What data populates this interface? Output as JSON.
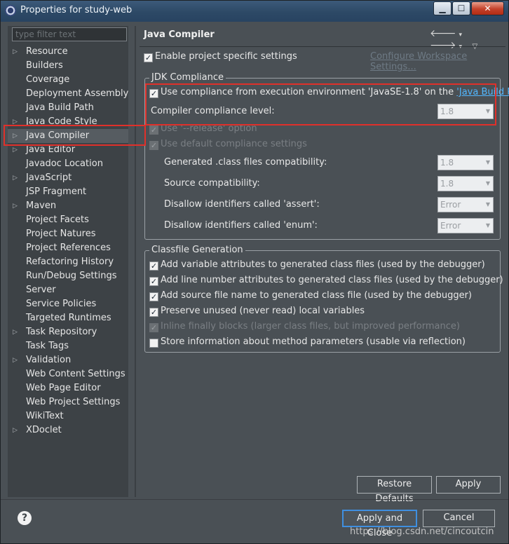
{
  "window": {
    "title": "Properties for study-web"
  },
  "filter": {
    "placeholder": "type filter text"
  },
  "tree": [
    {
      "label": "Resource",
      "expandable": true
    },
    {
      "label": "Builders",
      "expandable": false
    },
    {
      "label": "Coverage",
      "expandable": false
    },
    {
      "label": "Deployment Assembly",
      "expandable": false
    },
    {
      "label": "Java Build Path",
      "expandable": false
    },
    {
      "label": "Java Code Style",
      "expandable": true
    },
    {
      "label": "Java Compiler",
      "expandable": true,
      "selected": true
    },
    {
      "label": "Java Editor",
      "expandable": true
    },
    {
      "label": "Javadoc Location",
      "expandable": false
    },
    {
      "label": "JavaScript",
      "expandable": true
    },
    {
      "label": "JSP Fragment",
      "expandable": false
    },
    {
      "label": "Maven",
      "expandable": true
    },
    {
      "label": "Project Facets",
      "expandable": false
    },
    {
      "label": "Project Natures",
      "expandable": false
    },
    {
      "label": "Project References",
      "expandable": false
    },
    {
      "label": "Refactoring History",
      "expandable": false
    },
    {
      "label": "Run/Debug Settings",
      "expandable": false
    },
    {
      "label": "Server",
      "expandable": false
    },
    {
      "label": "Service Policies",
      "expandable": false
    },
    {
      "label": "Targeted Runtimes",
      "expandable": false
    },
    {
      "label": "Task Repository",
      "expandable": true
    },
    {
      "label": "Task Tags",
      "expandable": false
    },
    {
      "label": "Validation",
      "expandable": true
    },
    {
      "label": "Web Content Settings",
      "expandable": false
    },
    {
      "label": "Web Page Editor",
      "expandable": false
    },
    {
      "label": "Web Project Settings",
      "expandable": false
    },
    {
      "label": "WikiText",
      "expandable": false
    },
    {
      "label": "XDoclet",
      "expandable": true
    }
  ],
  "page": {
    "title": "Java Compiler",
    "enable_specific": "Enable project specific settings",
    "configure_workspace": "Configure Workspace Settings..."
  },
  "jdk": {
    "legend": "JDK Compliance",
    "use_compliance_prefix": "Use compliance from execution environment 'JavaSE-1.8' on the ",
    "java_build_path_link": "'Java Build Path'",
    "compliance_level_label": "Compiler compliance level:",
    "compliance_level_value": "1.8",
    "use_release": "Use '--release' option",
    "use_default": "Use default compliance settings",
    "generated_label": "Generated .class files compatibility:",
    "generated_value": "1.8",
    "source_label": "Source compatibility:",
    "source_value": "1.8",
    "assert_label": "Disallow identifiers called 'assert':",
    "assert_value": "Error",
    "enum_label": "Disallow identifiers called 'enum':",
    "enum_value": "Error"
  },
  "classfile": {
    "legend": "Classfile Generation",
    "items": [
      {
        "label": "Add variable attributes to generated class files (used by the debugger)",
        "checked": true,
        "disabled": false
      },
      {
        "label": "Add line number attributes to generated class files (used by the debugger)",
        "checked": true,
        "disabled": false
      },
      {
        "label": "Add source file name to generated class file (used by the debugger)",
        "checked": true,
        "disabled": false
      },
      {
        "label": "Preserve unused (never read) local variables",
        "checked": true,
        "disabled": false
      },
      {
        "label": "Inline finally blocks (larger class files, but improved performance)",
        "checked": true,
        "disabled": true
      },
      {
        "label": "Store information about method parameters (usable via reflection)",
        "checked": false,
        "disabled": false
      }
    ]
  },
  "buttons": {
    "restore_defaults": "Restore Defaults",
    "apply": "Apply",
    "apply_and_close": "Apply and Close",
    "cancel": "Cancel"
  },
  "watermark": "https://blog.csdn.net/cincoutcin",
  "colors": {
    "highlight_box": "#e0302a",
    "link": "#52b7ff",
    "background": "#4a5055"
  }
}
